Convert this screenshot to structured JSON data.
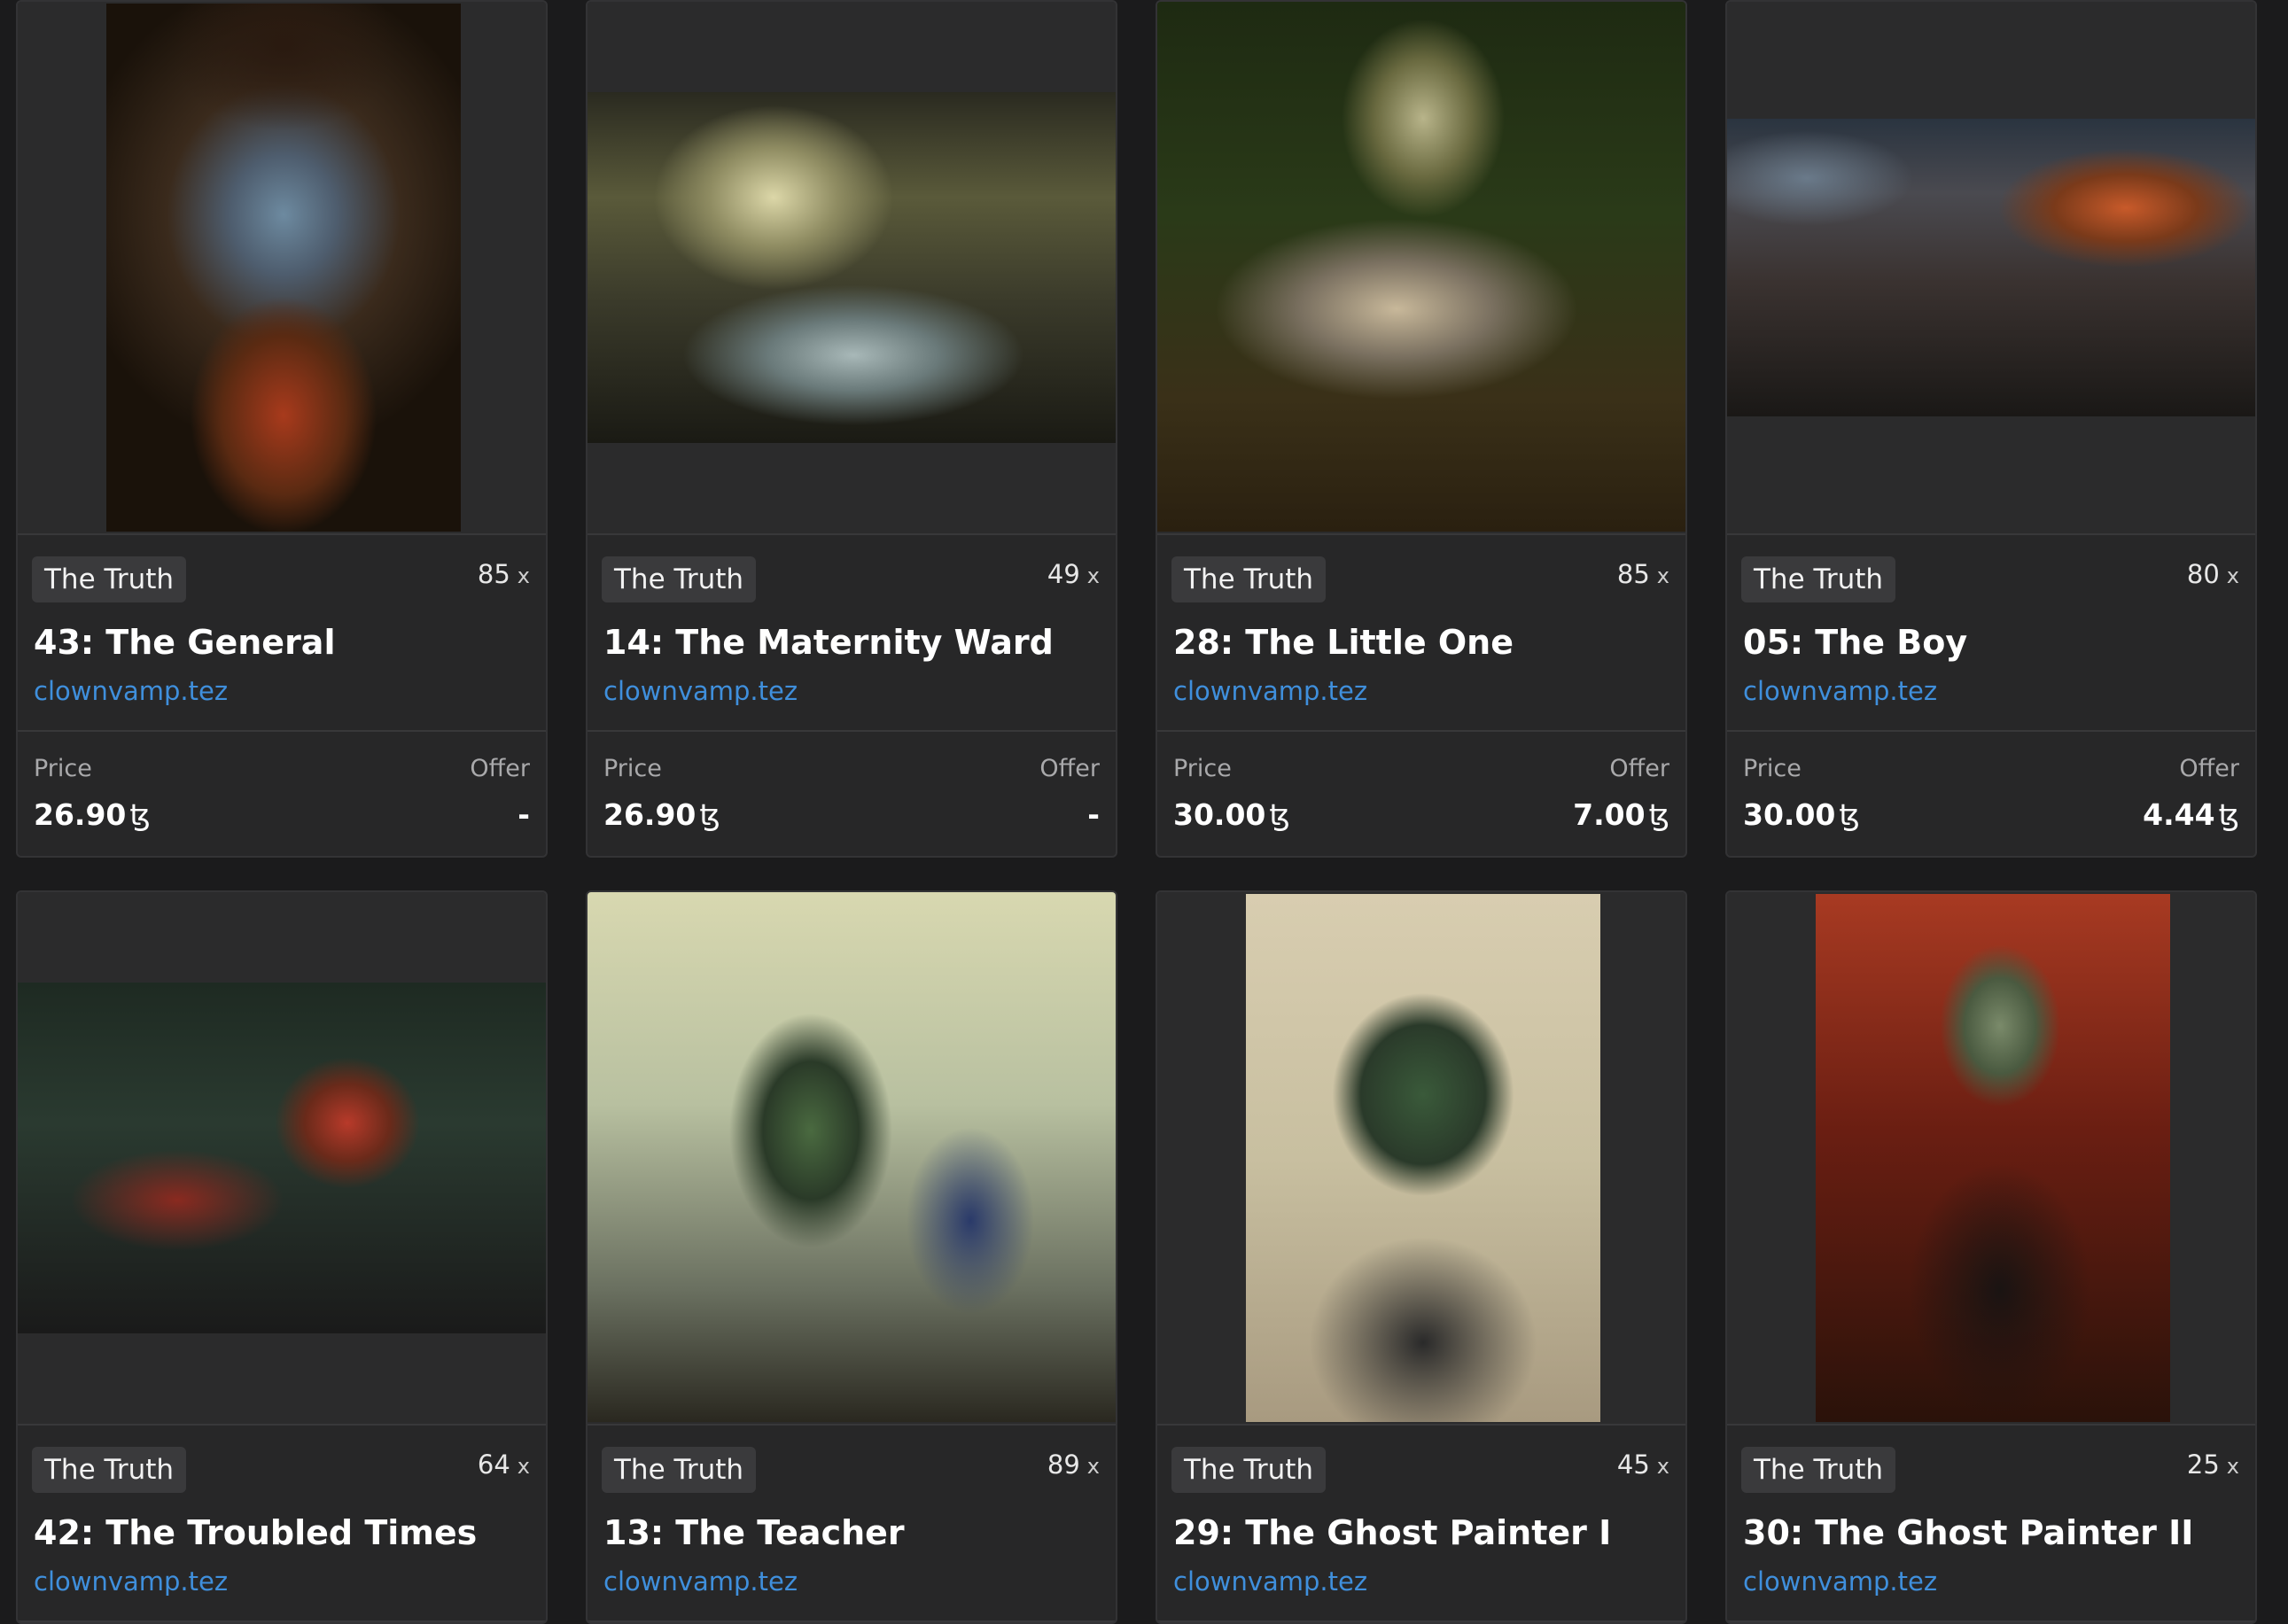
{
  "cards": [
    {
      "collection": "The Truth",
      "editions": "85",
      "editions_mark": "x",
      "title": "43: The General",
      "creator": "clownvamp.tez",
      "price_label": "Price",
      "price": "26.90",
      "offer_label": "Offer",
      "offer": "-",
      "currency": "ꜩ"
    },
    {
      "collection": "The Truth",
      "editions": "49",
      "editions_mark": "x",
      "title": "14: The Maternity Ward",
      "creator": "clownvamp.tez",
      "price_label": "Price",
      "price": "26.90",
      "offer_label": "Offer",
      "offer": "-",
      "currency": "ꜩ"
    },
    {
      "collection": "The Truth",
      "editions": "85",
      "editions_mark": "x",
      "title": "28: The Little One",
      "creator": "clownvamp.tez",
      "price_label": "Price",
      "price": "30.00",
      "offer_label": "Offer",
      "offer": "7.00",
      "currency": "ꜩ"
    },
    {
      "collection": "The Truth",
      "editions": "80",
      "editions_mark": "x",
      "title": "05: The Boy",
      "creator": "clownvamp.tez",
      "price_label": "Price",
      "price": "30.00",
      "offer_label": "Offer",
      "offer": "4.44",
      "currency": "ꜩ"
    },
    {
      "collection": "The Truth",
      "editions": "64",
      "editions_mark": "x",
      "title": "42: The Troubled Times",
      "creator": "clownvamp.tez"
    },
    {
      "collection": "The Truth",
      "editions": "89",
      "editions_mark": "x",
      "title": "13: The Teacher",
      "creator": "clownvamp.tez"
    },
    {
      "collection": "The Truth",
      "editions": "45",
      "editions_mark": "x",
      "title": "29: The Ghost Painter I",
      "creator": "clownvamp.tez"
    },
    {
      "collection": "The Truth",
      "editions": "25",
      "editions_mark": "x",
      "title": "30: The Ghost Painter II",
      "creator": "clownvamp.tez"
    }
  ],
  "colors": {
    "background": "#1b1b1c",
    "card": "#272728",
    "creator_link": "#3f8fdc",
    "tag_bg": "#3a3a3c"
  }
}
